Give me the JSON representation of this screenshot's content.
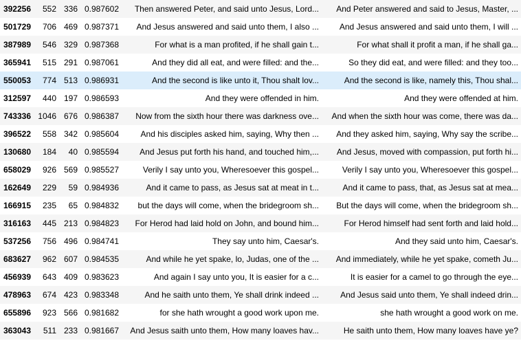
{
  "rows": [
    {
      "id": "392256",
      "a": "552",
      "b": "336",
      "score": "0.987602",
      "text1": "Then answered Peter, and said unto Jesus, Lord...",
      "text2": "And Peter answered and said to Jesus, Master, ..."
    },
    {
      "id": "501729",
      "a": "706",
      "b": "469",
      "score": "0.987371",
      "text1": "And Jesus answered and said unto them, I also ...",
      "text2": "And Jesus answered and said unto them, I will ..."
    },
    {
      "id": "387989",
      "a": "546",
      "b": "329",
      "score": "0.987368",
      "text1": "For what is a man profited, if he shall gain t...",
      "text2": "For what shall it profit a man, if he shall ga..."
    },
    {
      "id": "365941",
      "a": "515",
      "b": "291",
      "score": "0.987061",
      "text1": "And they did all eat, and were filled: and the...",
      "text2": "So they did eat, and were filled: and they too..."
    },
    {
      "id": "550053",
      "a": "774",
      "b": "513",
      "score": "0.986931",
      "text1": "And the second is like unto it, Thou shalt lov...",
      "text2": "And the second is like, namely this, Thou shal...",
      "highlighted": true
    },
    {
      "id": "312597",
      "a": "440",
      "b": "197",
      "score": "0.986593",
      "text1": "And they were offended in him.",
      "text2": "And they were offended at him."
    },
    {
      "id": "743336",
      "a": "1046",
      "b": "676",
      "score": "0.986387",
      "text1": "Now from the sixth hour there was darkness ove...",
      "text2": "And when the sixth hour was come, there was da..."
    },
    {
      "id": "396522",
      "a": "558",
      "b": "342",
      "score": "0.985604",
      "text1": "And his disciples asked him, saying, Why then ...",
      "text2": "And they asked him, saying, Why say the scribe..."
    },
    {
      "id": "130680",
      "a": "184",
      "b": "40",
      "score": "0.985594",
      "text1": "And Jesus put forth his hand, and touched him,...",
      "text2": "And Jesus, moved with compassion, put forth hi..."
    },
    {
      "id": "658029",
      "a": "926",
      "b": "569",
      "score": "0.985527",
      "text1": "Verily I say unto you, Wheresoever this gospel...",
      "text2": "Verily I say unto you, Wheresoever this gospel..."
    },
    {
      "id": "162649",
      "a": "229",
      "b": "59",
      "score": "0.984936",
      "text1": "And it came to pass, as Jesus sat at meat in t...",
      "text2": "And it came to pass, that, as Jesus sat at mea..."
    },
    {
      "id": "166915",
      "a": "235",
      "b": "65",
      "score": "0.984832",
      "text1": "but the days will come, when the bridegroom sh...",
      "text2": "But the days will come, when the bridegroom sh..."
    },
    {
      "id": "316163",
      "a": "445",
      "b": "213",
      "score": "0.984823",
      "text1": "For Herod had laid hold on John, and bound him...",
      "text2": "For Herod himself had sent forth and laid hold..."
    },
    {
      "id": "537256",
      "a": "756",
      "b": "496",
      "score": "0.984741",
      "text1": "They say unto him, Caesar's.",
      "text2": "And they said unto him, Caesar's."
    },
    {
      "id": "683627",
      "a": "962",
      "b": "607",
      "score": "0.984535",
      "text1": "And while he yet spake, lo, Judas, one of the ...",
      "text2": "And immediately, while he yet spake, cometh Ju..."
    },
    {
      "id": "456939",
      "a": "643",
      "b": "409",
      "score": "0.983623",
      "text1": "And again I say unto you, It is easier for a c...",
      "text2": "It is easier for a camel to go through the eye..."
    },
    {
      "id": "478963",
      "a": "674",
      "b": "423",
      "score": "0.983348",
      "text1": "And he saith unto them, Ye shall drink indeed ...",
      "text2": "And Jesus said unto them, Ye shall indeed drin..."
    },
    {
      "id": "655896",
      "a": "923",
      "b": "566",
      "score": "0.981682",
      "text1": "for she hath wrought a good work upon me.",
      "text2": "she hath wrought a good work on me."
    },
    {
      "id": "363043",
      "a": "511",
      "b": "233",
      "score": "0.981667",
      "text1": "And Jesus saith unto them, How many loaves hav...",
      "text2": "He saith unto them, How many loaves have ye?"
    }
  ]
}
